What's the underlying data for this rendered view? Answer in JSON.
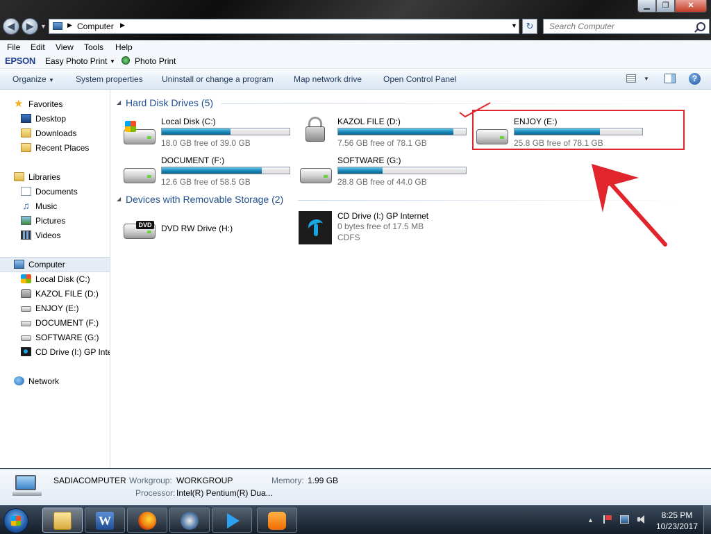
{
  "window": {
    "min_label": "▁",
    "max_label": "❐",
    "close_label": "✕"
  },
  "address": {
    "path": "Computer",
    "sep": "▶"
  },
  "search": {
    "placeholder": "Search Computer"
  },
  "menu": [
    "File",
    "Edit",
    "View",
    "Tools",
    "Help"
  ],
  "epson": {
    "logo": "EPSON",
    "app": "Easy Photo Print",
    "photo_print": "Photo Print"
  },
  "commands": {
    "organize": "Organize",
    "system_properties": "System properties",
    "uninstall": "Uninstall or change a program",
    "map_drive": "Map network drive",
    "control_panel": "Open Control Panel"
  },
  "nav": {
    "favorites": "Favorites",
    "desktop": "Desktop",
    "downloads": "Downloads",
    "recent": "Recent Places",
    "libraries": "Libraries",
    "documents": "Documents",
    "music": "Music",
    "pictures": "Pictures",
    "videos": "Videos",
    "computer": "Computer",
    "drive_c": "Local Disk (C:)",
    "drive_d": "KAZOL FILE (D:)",
    "drive_e": "ENJOY (E:)",
    "drive_f": "DOCUMENT (F:)",
    "drive_g": "SOFTWARE (G:)",
    "drive_i": "CD Drive (I:) GP Inter",
    "network": "Network"
  },
  "groups": {
    "hdd": "Hard Disk Drives (5)",
    "removable": "Devices with Removable Storage (2)"
  },
  "drives": {
    "c": {
      "name": "Local Disk (C:)",
      "info": "18.0 GB free of 39.0 GB",
      "used_fraction": 0.54
    },
    "d": {
      "name": "KAZOL FILE (D:)",
      "info": "7.56 GB free of 78.1 GB",
      "used_fraction": 0.9
    },
    "e": {
      "name": "ENJOY (E:)",
      "info": "25.8 GB free of 78.1 GB",
      "used_fraction": 0.67
    },
    "f": {
      "name": "DOCUMENT (F:)",
      "info": "12.6 GB free of 58.5 GB",
      "used_fraction": 0.78
    },
    "g": {
      "name": "SOFTWARE (G:)",
      "info": "28.8 GB free of 44.0 GB",
      "used_fraction": 0.35
    },
    "h": {
      "name": "DVD RW Drive (H:)",
      "badge": "DVD"
    },
    "i": {
      "name": "CD Drive (I:) GP Internet",
      "info": "0 bytes free of 17.5 MB",
      "fs": "CDFS"
    }
  },
  "details": {
    "computer_name": "SADIACOMPUTER",
    "workgroup_label": "Workgroup:",
    "workgroup": "WORKGROUP",
    "memory_label": "Memory:",
    "memory": "1.99 GB",
    "processor_label": "Processor:",
    "processor": "Intel(R) Pentium(R) Dua..."
  },
  "taskbar": {
    "word_letter": "W",
    "time": "8:25 PM",
    "date": "10/23/2017"
  },
  "colors": {
    "accent": "#1e4e8c",
    "bar_fill": "#1987b7",
    "annotation_red": "#e0252c"
  }
}
